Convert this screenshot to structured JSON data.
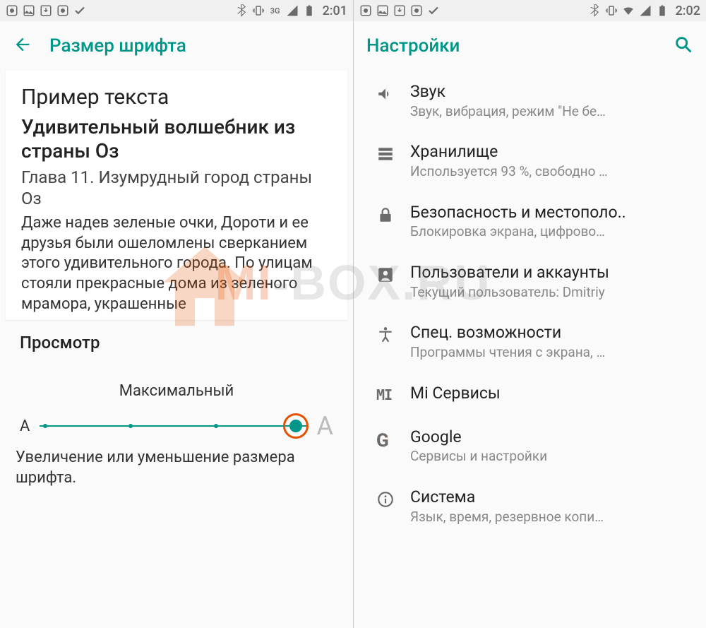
{
  "left": {
    "statusbar": {
      "time": "2:01",
      "network": "3G"
    },
    "appbar": {
      "title": "Размер шрифта"
    },
    "sample": {
      "heading": "Пример текста",
      "title": "Удивительный волшебник из страны Оз",
      "chapter": "Глава 11. Изумрудный город страны Оз",
      "body": "Даже надев зеленые очки, Дороти и ее друзья были ошеломлены сверканием этого удивительного города. По улицам стояли прекрасные дома из зеленого мрамора, украшенные"
    },
    "preview_label": "Просмотр",
    "slider": {
      "label": "Максимальный",
      "small": "A",
      "big": "A",
      "desc": "Увеличение или уменьшение размера шрифта."
    }
  },
  "right": {
    "statusbar": {
      "time": "2:02"
    },
    "appbar": {
      "title": "Настройки"
    },
    "items": [
      {
        "title": "Звук",
        "sub": "Звук, вибрация, режим \"Не бе…",
        "icon": "volume"
      },
      {
        "title": "Хранилище",
        "sub": "Используется 93 %, свободно …",
        "icon": "storage"
      },
      {
        "title": "Безопасность и местополо..",
        "sub": "Блокировка экрана, цифрово…",
        "icon": "lock"
      },
      {
        "title": "Пользователи и аккаунты",
        "sub": "Текущий пользователь: Dmitriy",
        "icon": "account"
      },
      {
        "title": "Спец. возможности",
        "sub": "Программы чтения с экрана, …",
        "icon": "accessibility"
      },
      {
        "title": "Mi Сервисы",
        "sub": "",
        "icon": "mi"
      },
      {
        "title": "Google",
        "sub": "Сервисы и настройки",
        "icon": "google"
      },
      {
        "title": "Система",
        "sub": "Язык, время, резервное копи…",
        "icon": "info"
      }
    ]
  },
  "watermark": "MI-BOX"
}
